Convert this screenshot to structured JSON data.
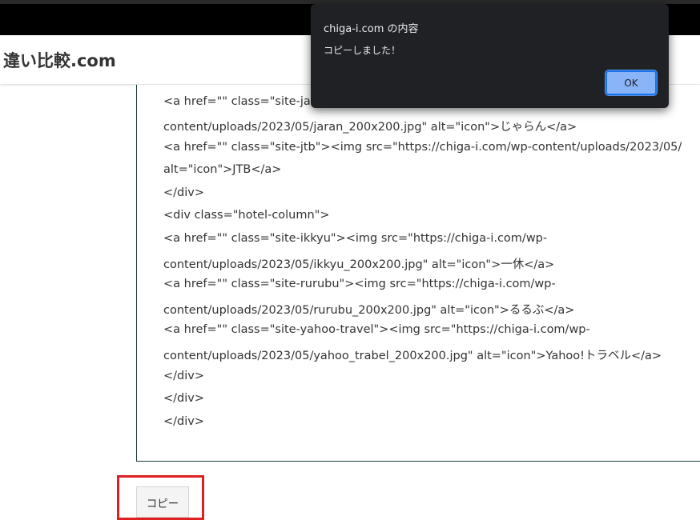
{
  "header": {
    "site_title": "違い比較.com"
  },
  "code_lines": [
    "<a href=\"\" class=\"site-ja",
    "content/uploads/2023/05/jaran_200x200.jpg\" alt=\"icon\">じゃらん</a>",
    "<a href=\"\" class=\"site-jtb\"><img src=\"https://chiga-i.com/wp-content/uploads/2023/05/",
    "alt=\"icon\">JTB</a>",
    "</div>",
    "<div class=\"hotel-column\">",
    "<a href=\"\" class=\"site-ikkyu\"><img src=\"https://chiga-i.com/wp-",
    "content/uploads/2023/05/ikkyu_200x200.jpg\" alt=\"icon\">一休</a>",
    "<a href=\"\" class=\"site-rurubu\"><img src=\"https://chiga-i.com/wp-",
    "content/uploads/2023/05/rurubu_200x200.jpg\" alt=\"icon\">るるぶ</a>",
    "<a href=\"\" class=\"site-yahoo-travel\"><img src=\"https://chiga-i.com/wp-",
    "content/uploads/2023/05/yahoo_trabel_200x200.jpg\" alt=\"icon\">Yahoo!トラベル</a>",
    "</div>",
    "</div>",
    "</div>"
  ],
  "copy_button": {
    "label": "コピー"
  },
  "dialog": {
    "title": "chiga-i.com の内容",
    "message": "コピーしました！",
    "ok_label": "OK"
  },
  "colors": {
    "dialog_bg": "#202124",
    "ok_button_bg": "#8ab4f8",
    "highlight_border": "#e02020"
  }
}
